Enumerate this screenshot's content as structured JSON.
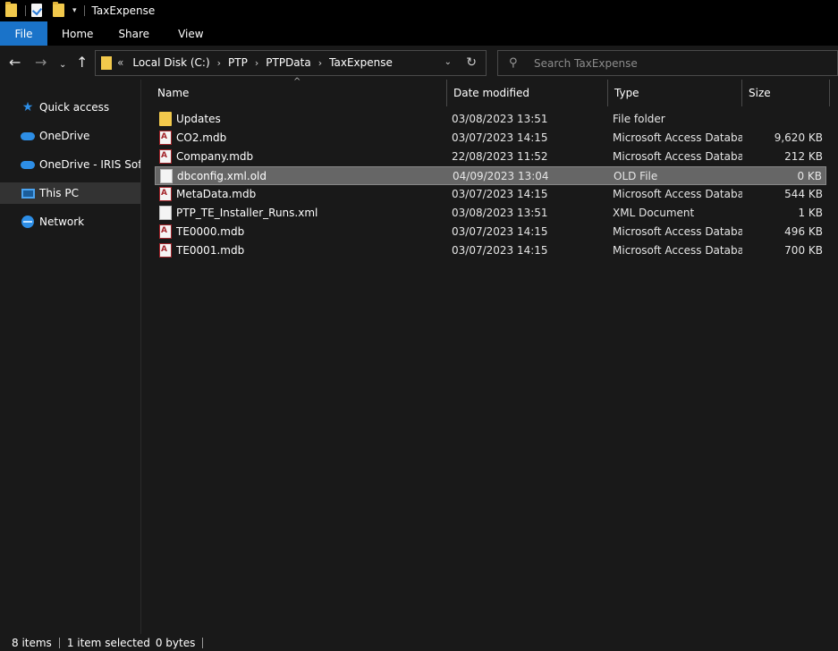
{
  "window": {
    "title": "TaxExpense"
  },
  "ribbon": {
    "tabs": [
      "File",
      "Home",
      "Share",
      "View"
    ]
  },
  "address": {
    "overflow": "«",
    "crumbs": [
      "Local Disk (C:)",
      "PTP",
      "PTPData",
      "TaxExpense"
    ]
  },
  "search": {
    "placeholder": "Search TaxExpense"
  },
  "sidebar": {
    "items": [
      {
        "label": "Quick access",
        "icon": "star-icon"
      },
      {
        "label": "OneDrive",
        "icon": "cloud-icon"
      },
      {
        "label": "OneDrive - IRIS Software",
        "icon": "cloud-icon"
      },
      {
        "label": "This PC",
        "icon": "computer-icon",
        "active": true
      },
      {
        "label": "Network",
        "icon": "network-icon"
      }
    ]
  },
  "columns": [
    "Name",
    "Date modified",
    "Type",
    "Size"
  ],
  "files": [
    {
      "name": "Updates",
      "date": "03/08/2023 13:51",
      "type": "File folder",
      "size": "",
      "icon": "folder-icon"
    },
    {
      "name": "CO2.mdb",
      "date": "03/07/2023 14:15",
      "type": "Microsoft Access Database",
      "size": "9,620 KB",
      "icon": "access-db-icon"
    },
    {
      "name": "Company.mdb",
      "date": "22/08/2023 11:52",
      "type": "Microsoft Access Database",
      "size": "212 KB",
      "icon": "access-db-icon"
    },
    {
      "name": "dbconfig.xml.old",
      "date": "04/09/2023 13:04",
      "type": "OLD File",
      "size": "0 KB",
      "icon": "file-icon",
      "selected": true
    },
    {
      "name": "MetaData.mdb",
      "date": "03/07/2023 14:15",
      "type": "Microsoft Access Database",
      "size": "544 KB",
      "icon": "access-db-icon"
    },
    {
      "name": "PTP_TE_Installer_Runs.xml",
      "date": "03/08/2023 13:51",
      "type": "XML Document",
      "size": "1 KB",
      "icon": "file-icon"
    },
    {
      "name": "TE0000.mdb",
      "date": "03/07/2023 14:15",
      "type": "Microsoft Access Database",
      "size": "496 KB",
      "icon": "access-db-icon"
    },
    {
      "name": "TE0001.mdb",
      "date": "03/07/2023 14:15",
      "type": "Microsoft Access Database",
      "size": "700 KB",
      "icon": "access-db-icon"
    }
  ],
  "status": {
    "count": "8 items",
    "selected": "1 item selected",
    "size": "0 bytes"
  }
}
